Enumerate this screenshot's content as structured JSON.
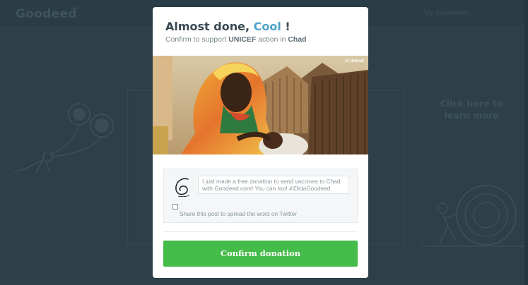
{
  "background": {
    "logo": "Goodeed",
    "logo_badge": "beta",
    "nav_link": "My Goodeeds",
    "learn_more": "Click here to learn more"
  },
  "modal": {
    "title_prefix": "Almost done, ",
    "title_name": "Cool",
    "title_suffix": " !",
    "subtitle_pre": "Confirm to support ",
    "subtitle_org": "UNICEF",
    "subtitle_mid": " action in ",
    "subtitle_place": "Chad",
    "photo_credit": "© Unicef",
    "share": {
      "tweet_text": "I just made a free donation to send vaccines to Chad with Goodeed.com! You can too! #IDidaGoodeed",
      "checkbox_label": "Share this post to spread the word on Twitter",
      "checked": false
    },
    "confirm_label": "Confirm donation"
  },
  "colors": {
    "accent": "#4ca4c8",
    "confirm": "#45bb49",
    "overlay": "#2d3f48"
  }
}
